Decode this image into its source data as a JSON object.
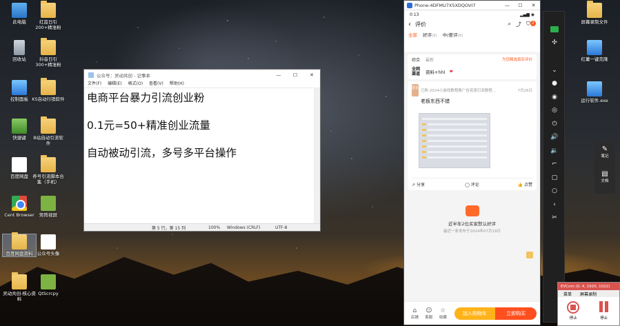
{
  "desktop": {
    "left_icons": [
      {
        "label": "此电脑",
        "icon": "computer-icon"
      },
      {
        "label": "红蓝日引200+精准粉",
        "icon": "folder-icon"
      },
      {
        "label": "回收站",
        "icon": "recycle-bin-icon"
      },
      {
        "label": "抖音日引300+精准粉",
        "icon": "folder-icon"
      },
      {
        "label": "控制面板",
        "icon": "control-panel-icon"
      },
      {
        "label": "KS自动行销软件",
        "icon": "folder-icon"
      },
      {
        "label": "快捷键",
        "icon": "shortcut-icon"
      },
      {
        "label": "B站自动引流软件",
        "icon": "folder-icon"
      },
      {
        "label": "百度网盘",
        "icon": "baidu-netdisk-icon"
      },
      {
        "label": "养号引流脚本合集（手机）",
        "icon": "folder-icon"
      },
      {
        "label": "Cent Browser",
        "icon": "browser-icon"
      },
      {
        "label": "矩阵视屏",
        "icon": "android-icon"
      },
      {
        "label": "百度网盘资料",
        "icon": "folder-icon"
      },
      {
        "label": "公众号头像",
        "icon": "wechat-icon"
      },
      {
        "label": "灵动共创-核心资料",
        "icon": "folder-icon"
      },
      {
        "label": "QtScrcpy",
        "icon": "android-icon"
      }
    ],
    "right_icons": [
      {
        "label": "屏幕录制文件",
        "icon": "folder-icon"
      },
      {
        "label": "红薯一键克隆",
        "icon": "app-icon"
      },
      {
        "label": "运行软件.exe",
        "icon": "app-icon"
      }
    ]
  },
  "notepad": {
    "title": "公众号：灵动共创 - 记事本",
    "menu": [
      "文件(F)",
      "编辑(E)",
      "格式(O)",
      "查看(V)",
      "帮助(H)"
    ],
    "lines": [
      "电商平台暴力引流创业粉",
      "",
      "0.1元=50+精准创业流量",
      "",
      "自动被动引流，多号多平台操作"
    ],
    "status": {
      "position": "第 5 行，第 15 列",
      "zoom": "100%",
      "line_ending": "Windows (CRLF)",
      "encoding": "UTF-8"
    }
  },
  "phone": {
    "window_title": "Phone-4DFMU7X5XDQOVI7",
    "status_time": "0:13",
    "nav_title": "评价",
    "cart_badge": "2",
    "tabs": [
      {
        "label": "全部",
        "count": ""
      },
      {
        "label": "好评",
        "count": "(2)"
      },
      {
        "label": "中/差评",
        "count": "(0)"
      }
    ],
    "sort": {
      "left": "综合",
      "right": "最新",
      "link": "为您精选真实评价"
    },
    "author_row": {
      "tag": "全网\n渠道",
      "text": "资料+hhl"
    },
    "review": {
      "avatar": "匿名",
      "meta": "已购 2024小游戏教程案广告资源引流教程…",
      "date": "7月26日",
      "text": "老板东西不错"
    },
    "actions": {
      "share": "分享",
      "comment": "评论",
      "like": "点赞"
    },
    "recommend": {
      "line1": "近半年2位买家默认好评",
      "line2": "最近一条发布于2024年07月19日"
    },
    "bottom": {
      "shop": "店铺",
      "service": "客服",
      "fav": "收藏",
      "add_cart": "加入购物车",
      "buy_now": "立即购买"
    }
  },
  "side_panel": {
    "note": "笔记",
    "doc": "文档"
  },
  "recorder": {
    "title": "EVCom (0, 4, 1920, 1022)",
    "tab1": "菜单",
    "tab2": "屏幕录制",
    "stop": "停止",
    "pause": "停止"
  }
}
